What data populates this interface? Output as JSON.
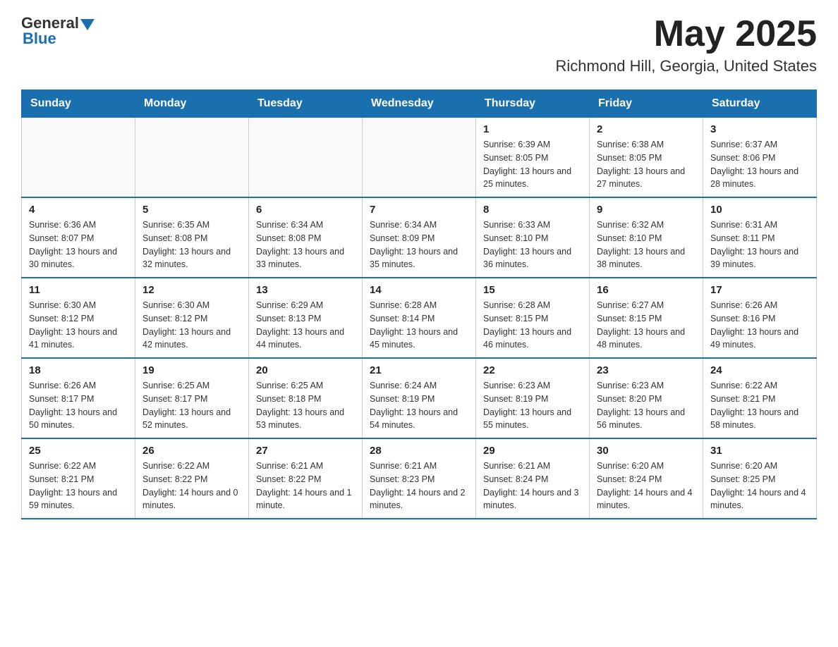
{
  "logo": {
    "general": "General",
    "blue": "Blue"
  },
  "title": "May 2025",
  "subtitle": "Richmond Hill, Georgia, United States",
  "days_of_week": [
    "Sunday",
    "Monday",
    "Tuesday",
    "Wednesday",
    "Thursday",
    "Friday",
    "Saturday"
  ],
  "weeks": [
    [
      {
        "day": "",
        "info": ""
      },
      {
        "day": "",
        "info": ""
      },
      {
        "day": "",
        "info": ""
      },
      {
        "day": "",
        "info": ""
      },
      {
        "day": "1",
        "info": "Sunrise: 6:39 AM\nSunset: 8:05 PM\nDaylight: 13 hours and 25 minutes."
      },
      {
        "day": "2",
        "info": "Sunrise: 6:38 AM\nSunset: 8:05 PM\nDaylight: 13 hours and 27 minutes."
      },
      {
        "day": "3",
        "info": "Sunrise: 6:37 AM\nSunset: 8:06 PM\nDaylight: 13 hours and 28 minutes."
      }
    ],
    [
      {
        "day": "4",
        "info": "Sunrise: 6:36 AM\nSunset: 8:07 PM\nDaylight: 13 hours and 30 minutes."
      },
      {
        "day": "5",
        "info": "Sunrise: 6:35 AM\nSunset: 8:08 PM\nDaylight: 13 hours and 32 minutes."
      },
      {
        "day": "6",
        "info": "Sunrise: 6:34 AM\nSunset: 8:08 PM\nDaylight: 13 hours and 33 minutes."
      },
      {
        "day": "7",
        "info": "Sunrise: 6:34 AM\nSunset: 8:09 PM\nDaylight: 13 hours and 35 minutes."
      },
      {
        "day": "8",
        "info": "Sunrise: 6:33 AM\nSunset: 8:10 PM\nDaylight: 13 hours and 36 minutes."
      },
      {
        "day": "9",
        "info": "Sunrise: 6:32 AM\nSunset: 8:10 PM\nDaylight: 13 hours and 38 minutes."
      },
      {
        "day": "10",
        "info": "Sunrise: 6:31 AM\nSunset: 8:11 PM\nDaylight: 13 hours and 39 minutes."
      }
    ],
    [
      {
        "day": "11",
        "info": "Sunrise: 6:30 AM\nSunset: 8:12 PM\nDaylight: 13 hours and 41 minutes."
      },
      {
        "day": "12",
        "info": "Sunrise: 6:30 AM\nSunset: 8:12 PM\nDaylight: 13 hours and 42 minutes."
      },
      {
        "day": "13",
        "info": "Sunrise: 6:29 AM\nSunset: 8:13 PM\nDaylight: 13 hours and 44 minutes."
      },
      {
        "day": "14",
        "info": "Sunrise: 6:28 AM\nSunset: 8:14 PM\nDaylight: 13 hours and 45 minutes."
      },
      {
        "day": "15",
        "info": "Sunrise: 6:28 AM\nSunset: 8:15 PM\nDaylight: 13 hours and 46 minutes."
      },
      {
        "day": "16",
        "info": "Sunrise: 6:27 AM\nSunset: 8:15 PM\nDaylight: 13 hours and 48 minutes."
      },
      {
        "day": "17",
        "info": "Sunrise: 6:26 AM\nSunset: 8:16 PM\nDaylight: 13 hours and 49 minutes."
      }
    ],
    [
      {
        "day": "18",
        "info": "Sunrise: 6:26 AM\nSunset: 8:17 PM\nDaylight: 13 hours and 50 minutes."
      },
      {
        "day": "19",
        "info": "Sunrise: 6:25 AM\nSunset: 8:17 PM\nDaylight: 13 hours and 52 minutes."
      },
      {
        "day": "20",
        "info": "Sunrise: 6:25 AM\nSunset: 8:18 PM\nDaylight: 13 hours and 53 minutes."
      },
      {
        "day": "21",
        "info": "Sunrise: 6:24 AM\nSunset: 8:19 PM\nDaylight: 13 hours and 54 minutes."
      },
      {
        "day": "22",
        "info": "Sunrise: 6:23 AM\nSunset: 8:19 PM\nDaylight: 13 hours and 55 minutes."
      },
      {
        "day": "23",
        "info": "Sunrise: 6:23 AM\nSunset: 8:20 PM\nDaylight: 13 hours and 56 minutes."
      },
      {
        "day": "24",
        "info": "Sunrise: 6:22 AM\nSunset: 8:21 PM\nDaylight: 13 hours and 58 minutes."
      }
    ],
    [
      {
        "day": "25",
        "info": "Sunrise: 6:22 AM\nSunset: 8:21 PM\nDaylight: 13 hours and 59 minutes."
      },
      {
        "day": "26",
        "info": "Sunrise: 6:22 AM\nSunset: 8:22 PM\nDaylight: 14 hours and 0 minutes."
      },
      {
        "day": "27",
        "info": "Sunrise: 6:21 AM\nSunset: 8:22 PM\nDaylight: 14 hours and 1 minute."
      },
      {
        "day": "28",
        "info": "Sunrise: 6:21 AM\nSunset: 8:23 PM\nDaylight: 14 hours and 2 minutes."
      },
      {
        "day": "29",
        "info": "Sunrise: 6:21 AM\nSunset: 8:24 PM\nDaylight: 14 hours and 3 minutes."
      },
      {
        "day": "30",
        "info": "Sunrise: 6:20 AM\nSunset: 8:24 PM\nDaylight: 14 hours and 4 minutes."
      },
      {
        "day": "31",
        "info": "Sunrise: 6:20 AM\nSunset: 8:25 PM\nDaylight: 14 hours and 4 minutes."
      }
    ]
  ]
}
